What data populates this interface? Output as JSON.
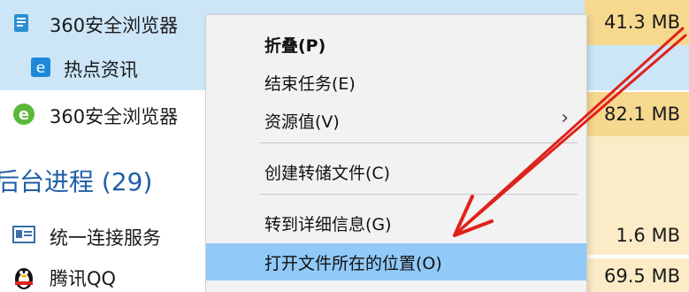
{
  "processes": [
    {
      "name": "360安全浏览器",
      "memory": "41.3 MB",
      "icon": "browser-doc-icon"
    },
    {
      "name": "热点资讯",
      "icon": "browser-e-icon"
    },
    {
      "name": "360安全浏览器",
      "memory": "82.1 MB",
      "icon": "browser-e-green-icon"
    }
  ],
  "background_group": {
    "title": "后台进程 (29)"
  },
  "background_processes": [
    {
      "name": "统一连接服务",
      "memory": "1.6 MB",
      "icon": "window-icon"
    },
    {
      "name": "腾讯QQ",
      "memory": "69.5 MB",
      "icon": "penguin-icon"
    }
  ],
  "context_menu": {
    "items": [
      {
        "label": "折叠(P)"
      },
      {
        "label": "结束任务(E)"
      },
      {
        "label": "资源值(V)",
        "submenu_glyph": "›"
      },
      {
        "label": "创建转储文件(C)"
      },
      {
        "label": "转到详细信息(G)"
      },
      {
        "label": "打开文件所在的位置(O)"
      }
    ]
  },
  "annotation": {
    "arrow_color": "#e0211b"
  }
}
